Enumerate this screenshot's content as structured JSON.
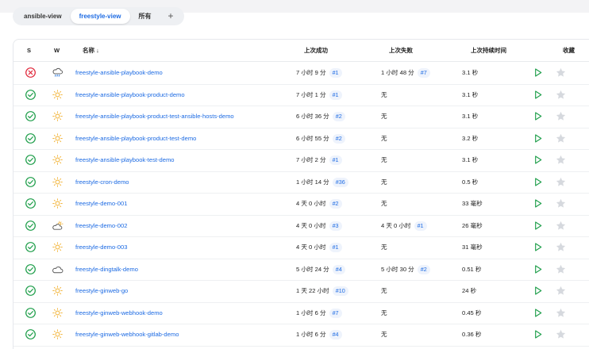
{
  "tabs": [
    {
      "label": "ansible-view",
      "active": false
    },
    {
      "label": "freestyle-view",
      "active": true
    },
    {
      "label": "所有",
      "active": false
    }
  ],
  "add_tab": "+",
  "columns": {
    "s": "S",
    "w": "W",
    "name": "名称 ↓",
    "last_success": "上次成功",
    "last_failure": "上次失败",
    "last_duration": "上次持续时间",
    "favorite": "收藏"
  },
  "jobs": [
    {
      "status": "failed",
      "weather": "rain",
      "name": "freestyle-ansible-playbook-demo",
      "success_time": "7 小时 9 分",
      "success_build": "#1",
      "failure_time": "1 小时 48 分",
      "failure_build": "#7",
      "duration": "3.1 秒"
    },
    {
      "status": "success",
      "weather": "sunny",
      "name": "freestyle-ansible-playbook-product-demo",
      "success_time": "7 小时 1 分",
      "success_build": "#1",
      "failure_time": "无",
      "failure_build": "",
      "duration": "3.1 秒"
    },
    {
      "status": "success",
      "weather": "sunny",
      "name": "freestyle-ansible-playbook-product-test-ansible-hosts-demo",
      "success_time": "6 小时 36 分",
      "success_build": "#2",
      "failure_time": "无",
      "failure_build": "",
      "duration": "3.1 秒"
    },
    {
      "status": "success",
      "weather": "sunny",
      "name": "freestyle-ansible-playbook-product-test-demo",
      "success_time": "6 小时 55 分",
      "success_build": "#2",
      "failure_time": "无",
      "failure_build": "",
      "duration": "3.2 秒"
    },
    {
      "status": "success",
      "weather": "sunny",
      "name": "freestyle-ansible-playbook-test-demo",
      "success_time": "7 小时 2 分",
      "success_build": "#1",
      "failure_time": "无",
      "failure_build": "",
      "duration": "3.1 秒"
    },
    {
      "status": "success",
      "weather": "sunny",
      "name": "freestyle-cron-demo",
      "success_time": "1 小时 14 分",
      "success_build": "#36",
      "failure_time": "无",
      "failure_build": "",
      "duration": "0.5 秒"
    },
    {
      "status": "success",
      "weather": "sunny",
      "name": "freestyle-demo-001",
      "success_time": "4 天 0 小时",
      "success_build": "#2",
      "failure_time": "无",
      "failure_build": "",
      "duration": "33 毫秒"
    },
    {
      "status": "success",
      "weather": "partly-cloudy",
      "name": "freestyle-demo-002",
      "success_time": "4 天 0 小时",
      "success_build": "#3",
      "failure_time": "4 天 0 小时",
      "failure_build": "#1",
      "duration": "26 毫秒"
    },
    {
      "status": "success",
      "weather": "sunny",
      "name": "freestyle-demo-003",
      "success_time": "4 天 0 小时",
      "success_build": "#1",
      "failure_time": "无",
      "failure_build": "",
      "duration": "31 毫秒"
    },
    {
      "status": "success",
      "weather": "cloudy",
      "name": "freestyle-dingtalk-demo",
      "success_time": "5 小时 24 分",
      "success_build": "#4",
      "failure_time": "5 小时 30 分",
      "failure_build": "#2",
      "duration": "0.51 秒"
    },
    {
      "status": "success",
      "weather": "sunny",
      "name": "freestyle-ginweb-go",
      "success_time": "1 天 22 小时",
      "success_build": "#10",
      "failure_time": "无",
      "failure_build": "",
      "duration": "24 秒"
    },
    {
      "status": "success",
      "weather": "sunny",
      "name": "freestyle-ginweb-webhook-demo",
      "success_time": "1 小时 6 分",
      "success_build": "#7",
      "failure_time": "无",
      "failure_build": "",
      "duration": "0.45 秒"
    },
    {
      "status": "success",
      "weather": "sunny",
      "name": "freestyle-ginweb-webhook-gitlab-demo",
      "success_time": "1 小时 6 分",
      "success_build": "#4",
      "failure_time": "无",
      "failure_build": "",
      "duration": "0.36 秒"
    }
  ],
  "colors": {
    "success": "#1e9e4a",
    "failure": "#e0263a",
    "link": "#1d6be3",
    "sun": "#f2b43a",
    "play": "#1e9e4a",
    "star": "#d6d9de"
  }
}
